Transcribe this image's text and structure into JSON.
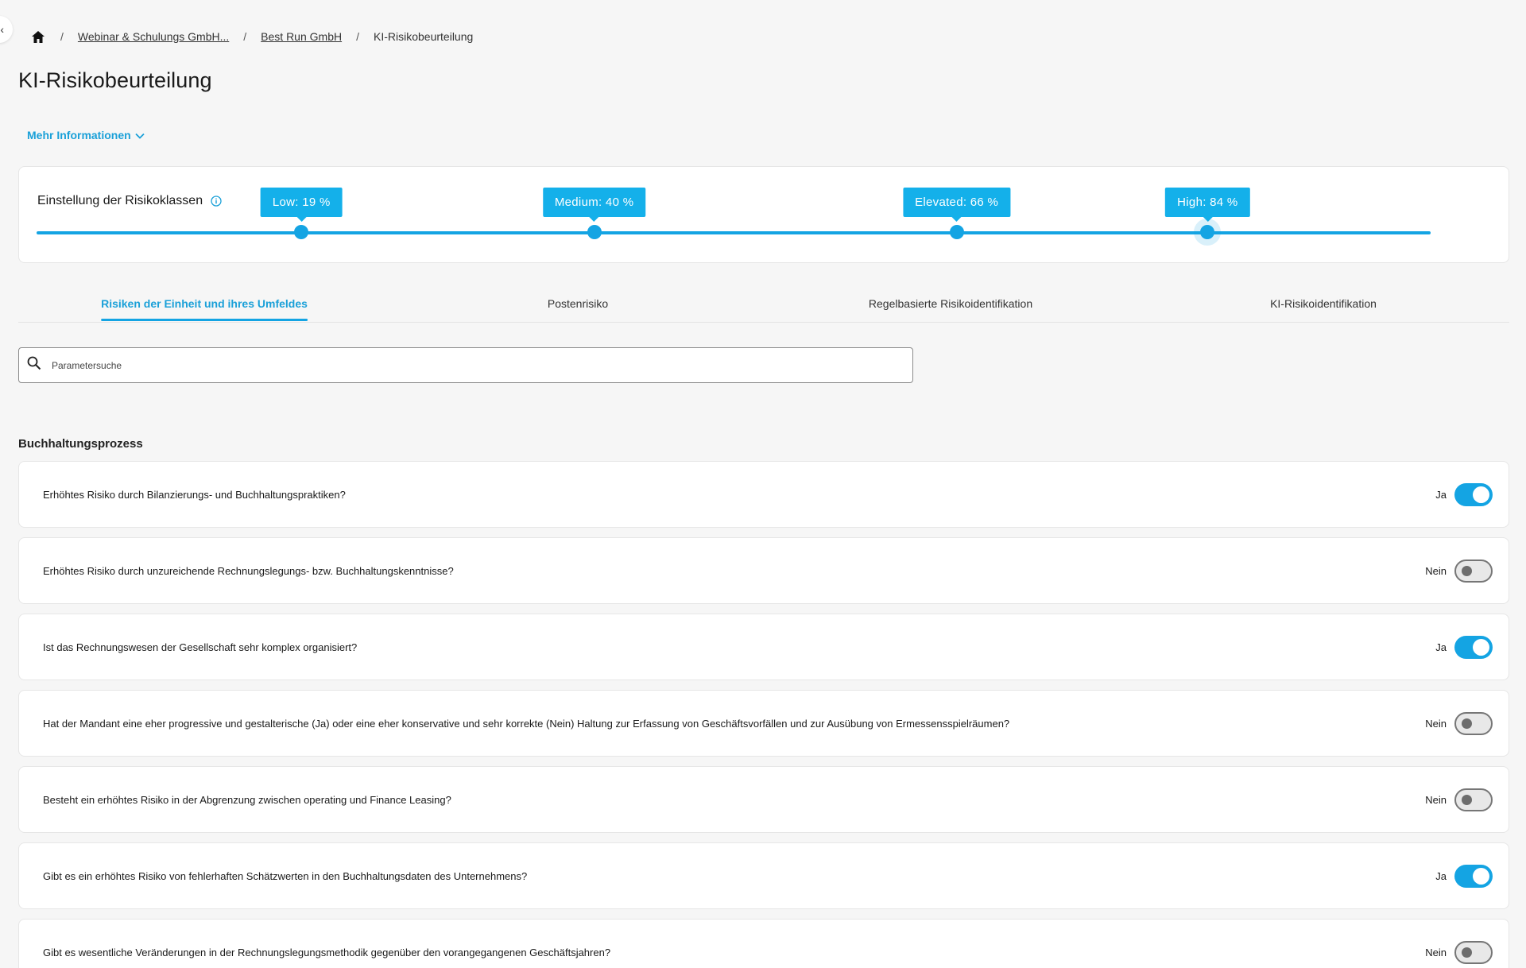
{
  "sidebar_toggle": {
    "icon": "chevron-left-icon"
  },
  "breadcrumb": {
    "home_icon": "home-icon",
    "items": [
      {
        "label": "Webinar & Schulungs GmbH..."
      },
      {
        "label": "Best Run GmbH"
      },
      {
        "label": "KI-Risikobeurteilung"
      }
    ]
  },
  "page": {
    "title": "KI-Risikobeurteilung"
  },
  "more_info": {
    "label": "Mehr Informationen"
  },
  "risk_classes": {
    "label": "Einstellung der Risikoklassen",
    "accent_color": "#14a4e3",
    "thresholds": [
      {
        "label": "Low: 19 %",
        "value": 19
      },
      {
        "label": "Medium: 40 %",
        "value": 40
      },
      {
        "label": "Elevated: 66 %",
        "value": 66
      },
      {
        "label": "High: 84 %",
        "value": 84
      }
    ]
  },
  "tabs": [
    {
      "label": "Risiken der Einheit und ihres Umfeldes",
      "active": true
    },
    {
      "label": "Postenrisiko",
      "active": false
    },
    {
      "label": "Regelbasierte Risikoidentifikation",
      "active": false
    },
    {
      "label": "KI-Risikoidentifikation",
      "active": false
    }
  ],
  "search": {
    "placeholder": "Parametersuche"
  },
  "section": {
    "title": "Buchhaltungsprozess"
  },
  "questions": [
    {
      "text": "Erhöhtes Risiko durch Bilanzierungs- und Buchhaltungspraktiken?",
      "value": "Ja",
      "on": true
    },
    {
      "text": "Erhöhtes Risiko durch unzureichende Rechnungslegungs- bzw. Buchhaltungskenntnisse?",
      "value": "Nein",
      "on": false
    },
    {
      "text": "Ist das Rechnungswesen der Gesellschaft sehr komplex organisiert?",
      "value": "Ja",
      "on": true
    },
    {
      "text": "Hat der Mandant eine eher progressive und gestalterische (Ja) oder eine eher konservative und sehr korrekte (Nein) Haltung zur Erfassung von Geschäftsvorfällen und zur Ausübung von Ermessensspielräumen?",
      "value": "Nein",
      "on": false
    },
    {
      "text": "Besteht ein erhöhtes Risiko in der Abgrenzung zwischen operating und Finance Leasing?",
      "value": "Nein",
      "on": false
    },
    {
      "text": "Gibt es ein erhöhtes Risiko von fehlerhaften Schätzwerten in den Buchhaltungsdaten des Unternehmens?",
      "value": "Ja",
      "on": true
    },
    {
      "text": "Gibt es wesentliche Veränderungen in der Rechnungslegungsmethodik gegenüber den vorangegangenen Geschäftsjahren?",
      "value": "Nein",
      "on": false
    }
  ]
}
